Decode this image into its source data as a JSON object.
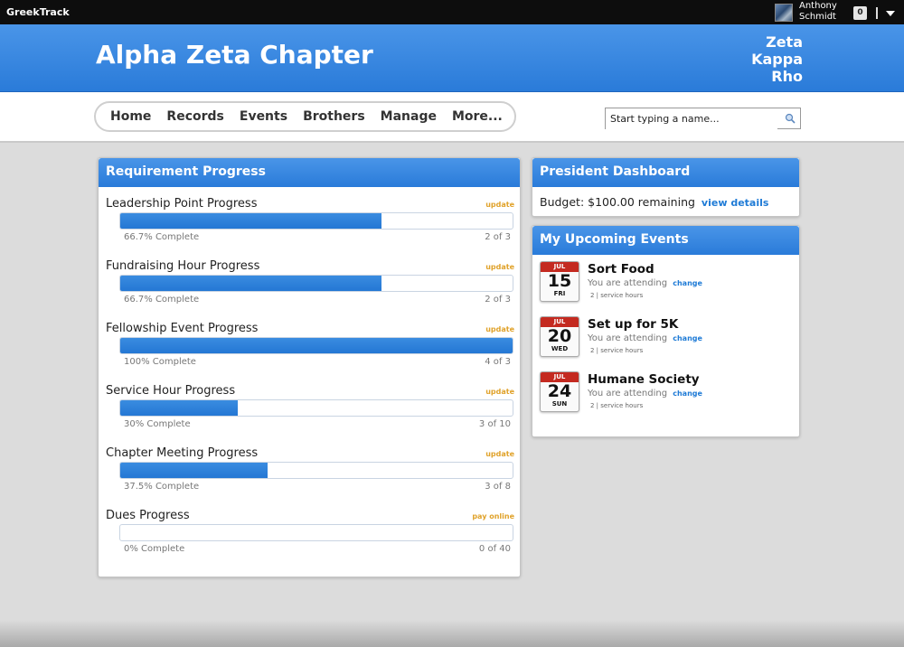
{
  "topbar": {
    "brand": "GreekTrack",
    "user_name": "Anthony Schmidt",
    "notification_count": "0"
  },
  "header": {
    "chapter_name": "Alpha Zeta Chapter",
    "org_name": "Zeta Kappa Rho"
  },
  "nav": {
    "items": [
      "Home",
      "Records",
      "Events",
      "Brothers",
      "Manage",
      "More..."
    ]
  },
  "search": {
    "placeholder": "Start typing a name..."
  },
  "requirement_panel": {
    "title": "Requirement Progress",
    "items": [
      {
        "label": "Leadership Point Progress",
        "action": "update",
        "percent_text": "66.7% Complete",
        "count": "2 of 3",
        "progress": 0.667
      },
      {
        "label": "Fundraising Hour Progress",
        "action": "update",
        "percent_text": "66.7% Complete",
        "count": "2 of 3",
        "progress": 0.667
      },
      {
        "label": "Fellowship Event Progress",
        "action": "update",
        "percent_text": "100% Complete",
        "count": "4 of 3",
        "progress": 1.0
      },
      {
        "label": "Service Hour Progress",
        "action": "update",
        "percent_text": "30% Complete",
        "count": "3 of 10",
        "progress": 0.3
      },
      {
        "label": "Chapter Meeting Progress",
        "action": "update",
        "percent_text": "37.5% Complete",
        "count": "3 of 8",
        "progress": 0.375
      },
      {
        "label": "Dues Progress",
        "action": "pay online",
        "percent_text": "0% Complete",
        "count": "0 of 40",
        "progress": 0.0
      }
    ]
  },
  "president_panel": {
    "title": "President Dashboard",
    "budget_text": "Budget: $100.00 remaining",
    "details_link": "view details"
  },
  "events_panel": {
    "title": "My Upcoming Events",
    "events": [
      {
        "month": "JUL",
        "day": "15",
        "weekday": "FRI",
        "title": "Sort Food",
        "status": "You are attending",
        "change": "change",
        "hours": "2 | service hours"
      },
      {
        "month": "JUL",
        "day": "20",
        "weekday": "WED",
        "title": "Set up for 5K",
        "status": "You are attending",
        "change": "change",
        "hours": "2 | service hours"
      },
      {
        "month": "JUL",
        "day": "24",
        "weekday": "SUN",
        "title": "Humane Society",
        "status": "You are attending",
        "change": "change",
        "hours": "2 | service hours"
      }
    ]
  },
  "colors": {
    "accent_blue": "#2a7bd9",
    "action_orange": "#e0a22a",
    "calendar_red": "#c42a20"
  }
}
